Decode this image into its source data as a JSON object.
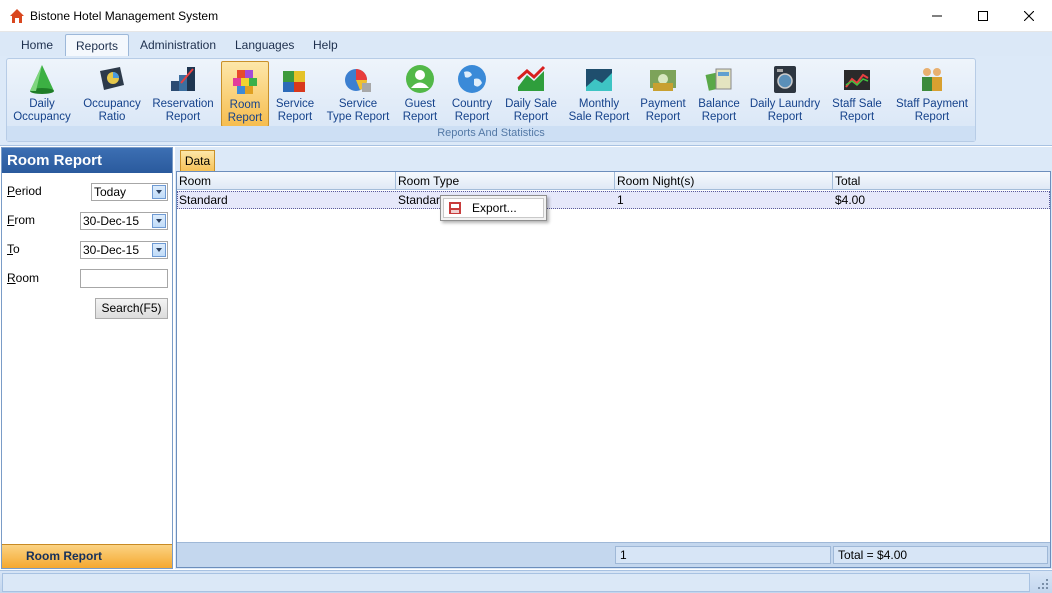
{
  "window": {
    "title": "Bistone Hotel Management System"
  },
  "menu": {
    "tabs": [
      {
        "label": "Home"
      },
      {
        "label": "Reports"
      },
      {
        "label": "Administration"
      },
      {
        "label": "Languages"
      },
      {
        "label": "Help"
      }
    ],
    "active_tab": "Reports"
  },
  "ribbon": {
    "group_label": "Reports And Statistics",
    "items": [
      {
        "line1": "Daily",
        "line2": "Occupancy",
        "icon": "daily-occupancy-icon"
      },
      {
        "line1": "Occupancy",
        "line2": "Ratio",
        "icon": "occupancy-ratio-icon"
      },
      {
        "line1": "Reservation",
        "line2": "Report",
        "icon": "reservation-report-icon"
      },
      {
        "line1": "Room",
        "line2": "Report",
        "icon": "room-report-icon"
      },
      {
        "line1": "Service",
        "line2": "Report",
        "icon": "service-report-icon"
      },
      {
        "line1": "Service",
        "line2": "Type Report",
        "icon": "service-type-report-icon"
      },
      {
        "line1": "Guest",
        "line2": "Report",
        "icon": "guest-report-icon"
      },
      {
        "line1": "Country",
        "line2": "Report",
        "icon": "country-report-icon"
      },
      {
        "line1": "Daily Sale",
        "line2": "Report",
        "icon": "daily-sale-report-icon"
      },
      {
        "line1": "Monthly",
        "line2": "Sale Report",
        "icon": "monthly-sale-report-icon"
      },
      {
        "line1": "Payment",
        "line2": "Report",
        "icon": "payment-report-icon"
      },
      {
        "line1": "Balance",
        "line2": "Report",
        "icon": "balance-report-icon"
      },
      {
        "line1": "Daily Laundry",
        "line2": "Report",
        "icon": "daily-laundry-report-icon"
      },
      {
        "line1": "Staff Sale",
        "line2": "Report",
        "icon": "staff-sale-report-icon"
      },
      {
        "line1": "Staff Payment",
        "line2": "Report",
        "icon": "staff-payment-report-icon"
      }
    ]
  },
  "left_panel": {
    "header": "Room Report",
    "period_label_prefix": "P",
    "period_label_rest": "eriod",
    "period_value": "Today",
    "from_label_prefix": "F",
    "from_label_rest": "rom",
    "from_value": "30-Dec-15",
    "to_label_prefix": "T",
    "to_label_rest": "o",
    "to_value": "30-Dec-15",
    "room_label_prefix": "R",
    "room_label_rest": "oom",
    "room_value": "",
    "search_button": "Search(F5)",
    "footer": "Room Report"
  },
  "main": {
    "tab_label": "Data",
    "columns": [
      "Room",
      "Room Type",
      "Room Night(s)",
      "Total"
    ],
    "rows": [
      [
        "Standard",
        "Standard",
        "1",
        "$4.00"
      ]
    ],
    "footer_nights": "1",
    "footer_total": "Total = $4.00"
  },
  "context_menu": {
    "items": [
      {
        "label": "Export...",
        "icon": "export-icon"
      }
    ]
  },
  "colors": {
    "accent_orange": "#f6bd4f",
    "ribbon_blue": "#dce9f8",
    "header_blue": "#2a5a9d"
  }
}
